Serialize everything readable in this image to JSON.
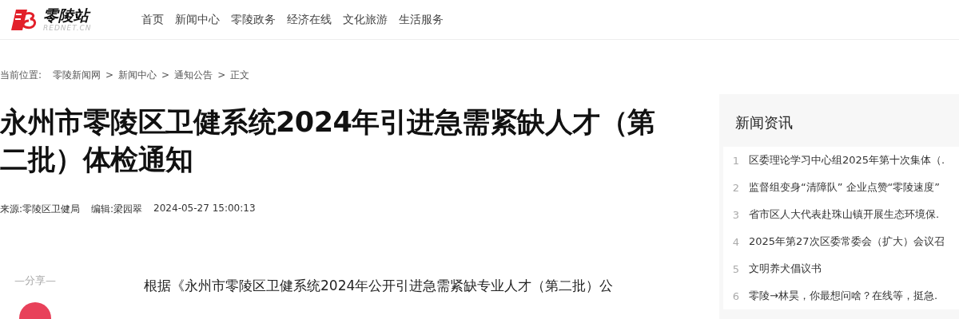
{
  "header": {
    "logo": {
      "name": "零陵站",
      "domain": "REDNET.CN"
    },
    "nav": [
      {
        "label": "首页"
      },
      {
        "label": "新闻中心"
      },
      {
        "label": "零陵政务"
      },
      {
        "label": "经济在线"
      },
      {
        "label": "文化旅游"
      },
      {
        "label": "生活服务"
      }
    ]
  },
  "breadcrumb": {
    "label": "当前位置:",
    "items": [
      {
        "label": "零陵新闻网"
      },
      {
        "label": "新闻中心"
      },
      {
        "label": "通知公告"
      },
      {
        "label": "正文"
      }
    ],
    "separator": ">"
  },
  "article": {
    "title": "永州市零陵区卫健系统2024年引进急需紧缺人才（第二批）体检通知",
    "meta": [
      {
        "label": "来源:",
        "value": "零陵区卫健局"
      },
      {
        "label": "编辑:",
        "value": "梁园翠"
      },
      {
        "value": "2024-05-27 15:00:13"
      }
    ],
    "share_label": "—分享—",
    "body_first_line": "根据《永州市零陵区卫健系统2024年公开引进急需紧缺专业人才（第二批）公"
  },
  "sidebar": {
    "title": "新闻资讯",
    "items": [
      {
        "rank": "1",
        "title": "区委理论学习中心组2025年第十次集体（."
      },
      {
        "rank": "2",
        "title": "监督组变身“清障队” 企业点赞“零陵速度”"
      },
      {
        "rank": "3",
        "title": "省市区人大代表赴珠山镇开展生态环境保."
      },
      {
        "rank": "4",
        "title": "2025年第27次区委常委会（扩大）会议召"
      },
      {
        "rank": "5",
        "title": "文明养犬倡议书"
      },
      {
        "rank": "6",
        "title": "零陵→林昊，你最想问啥？在线等，挺急."
      }
    ]
  }
}
